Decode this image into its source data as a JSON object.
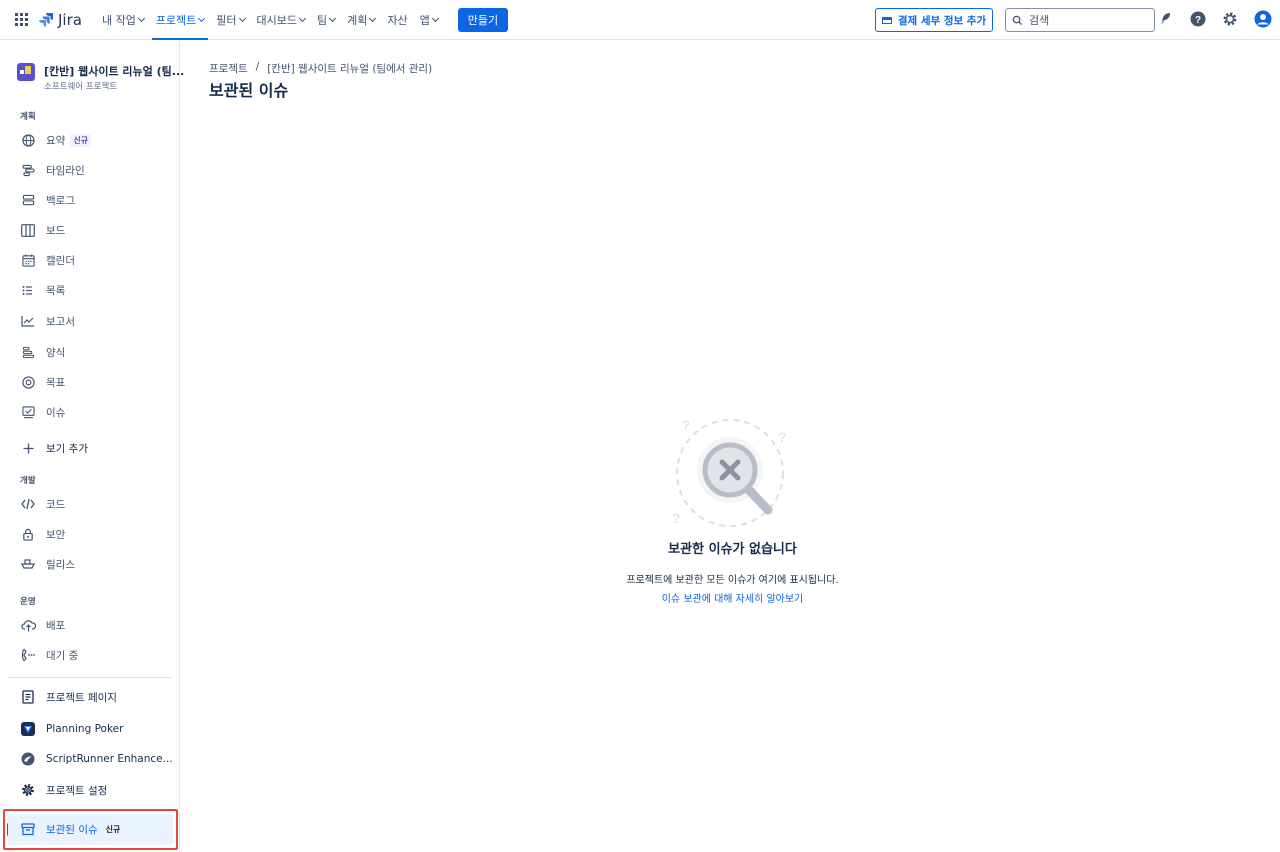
{
  "app": {
    "logo_text": "Jira"
  },
  "nav": {
    "items": [
      {
        "label": "내 작업",
        "dropdown": true
      },
      {
        "label": "프로젝트",
        "dropdown": true,
        "active": true
      },
      {
        "label": "필터",
        "dropdown": true
      },
      {
        "label": "대시보드",
        "dropdown": true
      },
      {
        "label": "팀",
        "dropdown": true
      },
      {
        "label": "계획",
        "dropdown": true
      },
      {
        "label": "자산",
        "dropdown": false
      },
      {
        "label": "앱",
        "dropdown": true
      }
    ],
    "create_label": "만들기",
    "billing_label": "결제 세부 정보 추가",
    "search_placeholder": "검색"
  },
  "sidebar": {
    "project_name": "[칸반] 웹사이트 리뉴얼 (팀...",
    "project_type": "소프트웨어 프로젝트",
    "section_plan": "계획",
    "plan_items": [
      {
        "label": "요약",
        "badge": "신규",
        "icon": "globe-icon"
      },
      {
        "label": "타임라인",
        "icon": "timeline-icon"
      },
      {
        "label": "백로그",
        "icon": "backlog-icon"
      },
      {
        "label": "보드",
        "icon": "board-icon"
      },
      {
        "label": "캘린더",
        "icon": "calendar-icon"
      },
      {
        "label": "목록",
        "icon": "list-icon"
      },
      {
        "label": "보고서",
        "icon": "reports-icon"
      },
      {
        "label": "양식",
        "icon": "forms-icon"
      },
      {
        "label": "목표",
        "icon": "goals-icon"
      },
      {
        "label": "이슈",
        "icon": "issues-icon"
      }
    ],
    "add_view_label": "보기 추가",
    "section_dev": "개발",
    "dev_items": [
      {
        "label": "코드",
        "icon": "code-icon"
      },
      {
        "label": "보안",
        "icon": "lock-icon"
      },
      {
        "label": "릴리스",
        "icon": "ship-icon"
      }
    ],
    "section_ops": "운영",
    "ops_items": [
      {
        "label": "배포",
        "icon": "cloud-upload-icon"
      },
      {
        "label": "대기 중",
        "icon": "on-call-icon"
      }
    ],
    "extra_items": [
      {
        "label": "프로젝트 페이지",
        "icon": "page-icon"
      },
      {
        "label": "Planning Poker",
        "icon": "planning-poker-icon"
      },
      {
        "label": "ScriptRunner Enhance...",
        "icon": "scriptrunner-icon"
      },
      {
        "label": "프로젝트 설정",
        "icon": "gear-icon"
      }
    ],
    "selected_item": {
      "label": "보관된 이슈",
      "badge": "신규",
      "icon": "archive-icon"
    }
  },
  "main": {
    "breadcrumb": [
      "프로젝트",
      "/",
      "[칸반] 웹사이트 리뉴얼 (팀에서 관리)"
    ],
    "title": "보관된 이슈",
    "empty_title": "보관한 이슈가 없습니다",
    "empty_desc": "프로젝트에 보관한 모든 이슈가 여기에 표시됩니다.",
    "empty_link": "이슈 보관에 대해 자세히 알아보기"
  },
  "colors": {
    "brand": "#0c66e4",
    "highlight_border": "#e2483d",
    "selected_bg": "#e9f2ff"
  }
}
